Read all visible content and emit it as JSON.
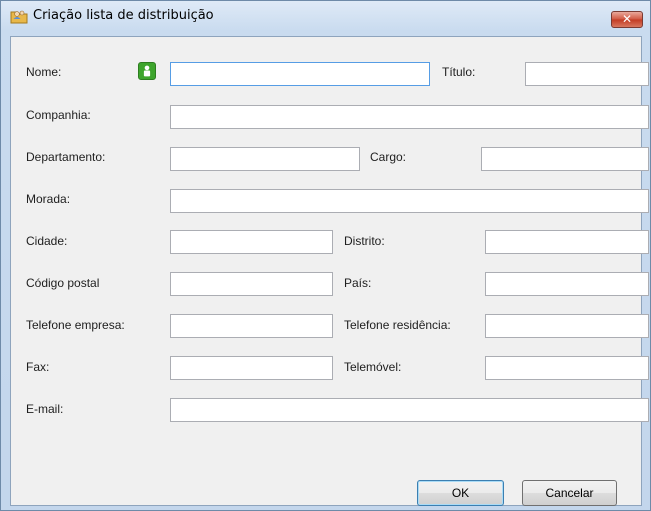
{
  "window": {
    "title": "Criação lista de distribuição",
    "close_glyph": "✕"
  },
  "icons": {
    "title_icon": "contacts-folder-icon",
    "contact_icon": "person-contact-icon"
  },
  "form": {
    "nome_label": "Nome:",
    "titulo_label": "Título:",
    "companhia_label": "Companhia:",
    "departamento_label": "Departamento:",
    "cargo_label": "Cargo:",
    "morada_label": "Morada:",
    "cidade_label": "Cidade:",
    "distrito_label": "Distrito:",
    "codigo_postal_label": "Código postal",
    "pais_label": "País:",
    "telefone_empresa_label": "Telefone empresa:",
    "telefone_residencia_label": "Telefone residência:",
    "fax_label": "Fax:",
    "telemovel_label": "Telemóvel:",
    "email_label": "E-mail:"
  },
  "buttons": {
    "ok_label": "OK",
    "cancel_label": "Cancelar"
  }
}
